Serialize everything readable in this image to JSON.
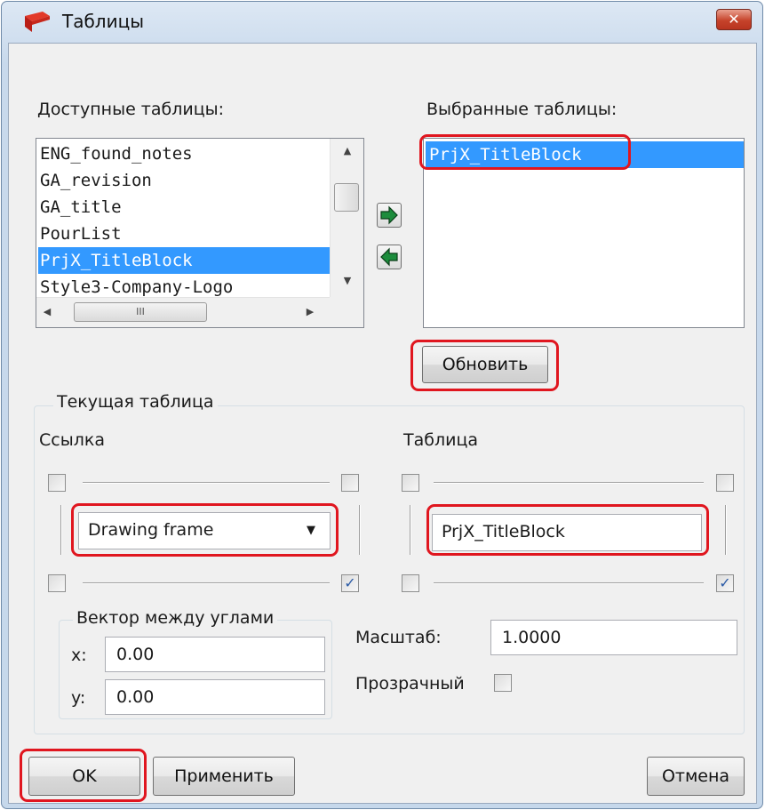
{
  "window": {
    "title": "Таблицы",
    "close_symbol": "✕"
  },
  "available": {
    "label": "Доступные таблицы:",
    "items": [
      "ENG_found_notes",
      "GA_revision",
      "GA_title",
      "PourList",
      "PrjX_TitleBlock",
      "Style3-Company-Logo"
    ],
    "selected_index": 4,
    "hscroll_grip": "III"
  },
  "selected_tables": {
    "label": "Выбранные таблицы:",
    "items": [
      "PrjX_TitleBlock"
    ]
  },
  "buttons": {
    "add_icon": "arrow-right-icon",
    "remove_icon": "arrow-left-icon",
    "update": "Обновить",
    "ok": "OK",
    "apply": "Применить",
    "cancel": "Отмена"
  },
  "current": {
    "group_label": "Текущая таблица",
    "ref_label": "Ссылка",
    "table_label": "Таблица",
    "ref_value": "Drawing frame",
    "table_value": "PrjX_TitleBlock",
    "ref_corners": {
      "top_left": false,
      "top_right": false,
      "bottom_left": false,
      "bottom_right": true
    },
    "table_corners": {
      "top_left": false,
      "top_right": false,
      "bottom_left": false,
      "bottom_right": true
    },
    "check_mark": "✓"
  },
  "vector": {
    "label": "Вектор между углами",
    "x_label": "x:",
    "x_value": "0.00",
    "y_label": "y:",
    "y_value": "0.00"
  },
  "scale": {
    "label": "Масштаб:",
    "value": "1.0000"
  },
  "transparent": {
    "label": "Прозрачный",
    "checked": false
  },
  "colors": {
    "highlight": "#e0161f",
    "selection": "#3399ff",
    "arrow_green": "#1c8c3c"
  }
}
